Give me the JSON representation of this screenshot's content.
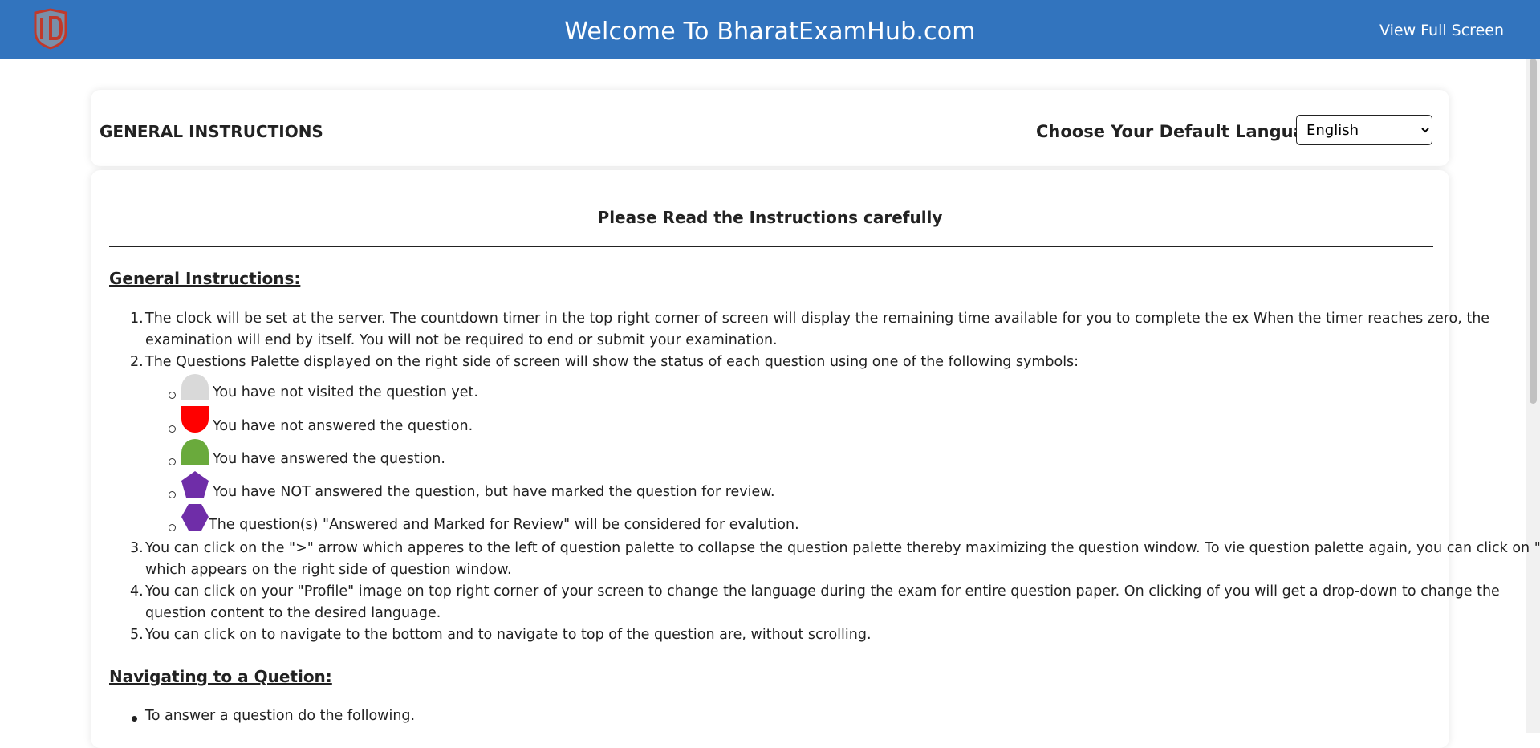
{
  "header": {
    "title": "Welcome To BharatExamHub.com",
    "fullscreen_label": "View Full Screen",
    "logo_icon": "shield-logo-icon",
    "bg_color": "#3274be"
  },
  "instructions_header": {
    "title": "GENERAL INSTRUCTIONS",
    "language_label": "Choose Your Default Language",
    "language_selected": "English"
  },
  "body": {
    "heading": "Please Read the Instructions carefully",
    "general_title": "General Instructions:",
    "items": [
      {
        "num": "1.",
        "line1": "The clock will be set at the server. The countdown timer in the top right corner of screen will display the remaining time available for you to complete the ex When the timer reaches zero, the",
        "line2": "examination will end by itself. You will not be required to end or submit your examination."
      },
      {
        "num": "2.",
        "line1": "The Questions Palette displayed on the right side of screen will show the status of each question using one of the following symbols:"
      },
      {
        "num": "3.",
        "line1": "You can click on the \">\" arrow which apperes to the left of question palette to collapse the question palette thereby maximizing the question window. To vie question palette again, you can click on \"<\"",
        "line2": "which appears on the right side of question window."
      },
      {
        "num": "4.",
        "line1": "You can click on your \"Profile\" image on top right corner of your screen to change the language during the exam for entire question paper. On clicking of you will get a drop-down to change the",
        "line2": "question content to the desired language."
      },
      {
        "num": "5.",
        "line1": "You can click on to navigate to the bottom and to navigate to top of the question are, without scrolling."
      }
    ],
    "symbols": [
      {
        "icon": "not-visited-icon",
        "color": "#d9d9d9",
        "text": "You have not visited the question yet."
      },
      {
        "icon": "not-answered-icon",
        "color": "#ff0000",
        "text": "You have not answered the question."
      },
      {
        "icon": "answered-icon",
        "color": "#6aaa3c",
        "text": "You have answered the question."
      },
      {
        "icon": "marked-for-review-icon",
        "color": "#6f2da8",
        "text": "You have NOT answered the question, but have marked the question for review."
      },
      {
        "icon": "answered-and-marked-icon",
        "color": "#6f2da8",
        "text": "The question(s) \"Answered and Marked for Review\" will be considered for evalution."
      }
    ],
    "navigating_title": "Navigating to a Quetion:",
    "navigating_items": [
      "To answer a question do the following."
    ]
  }
}
